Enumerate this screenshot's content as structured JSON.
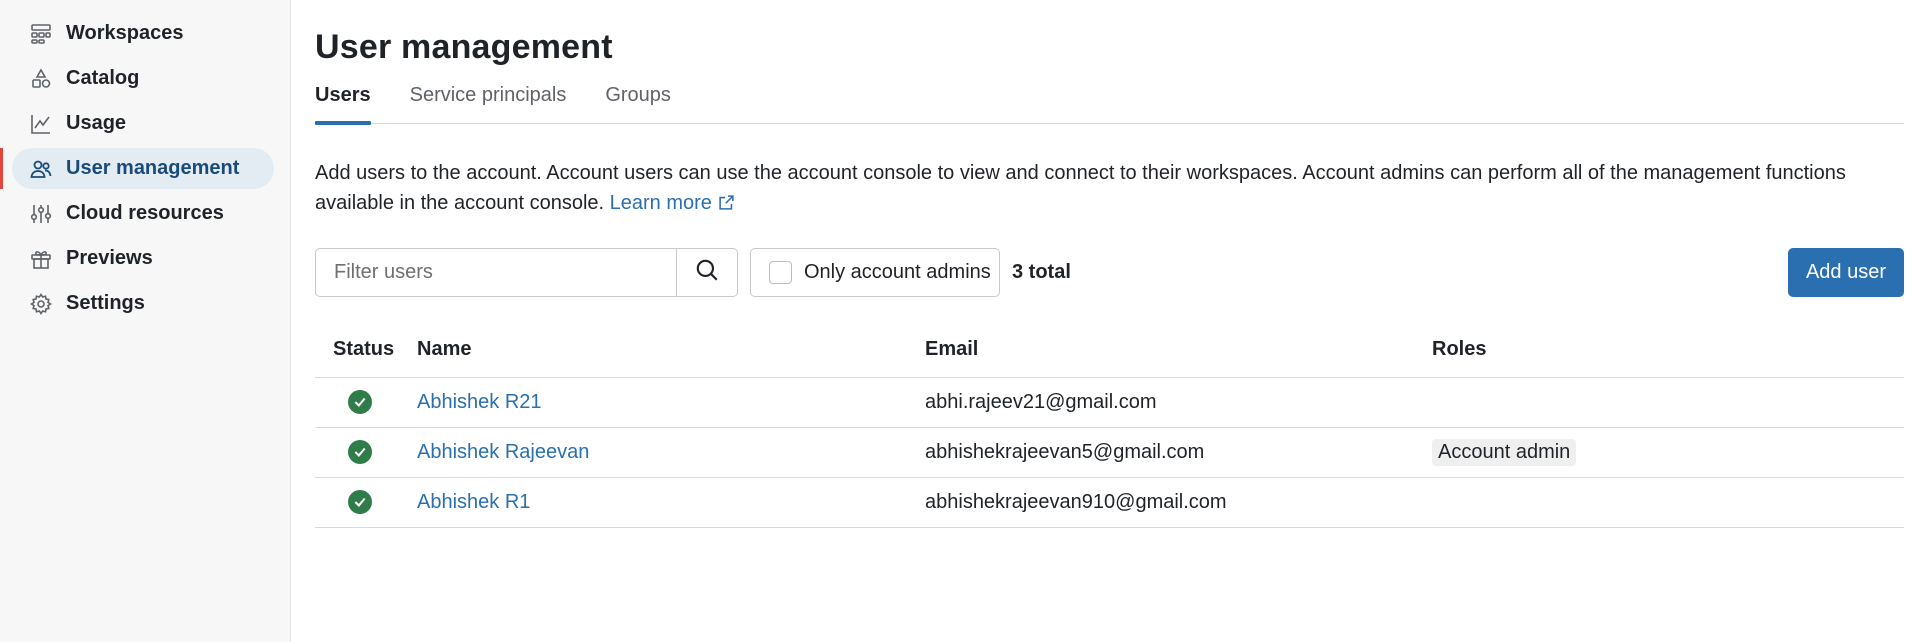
{
  "sidebar": {
    "items": [
      {
        "label": "Workspaces",
        "icon": "workspaces-icon"
      },
      {
        "label": "Catalog",
        "icon": "catalog-icon"
      },
      {
        "label": "Usage",
        "icon": "usage-chart-icon"
      },
      {
        "label": "User management",
        "icon": "users-icon",
        "active": true
      },
      {
        "label": "Cloud resources",
        "icon": "sliders-icon"
      },
      {
        "label": "Previews",
        "icon": "gift-icon"
      },
      {
        "label": "Settings",
        "icon": "gear-icon"
      }
    ]
  },
  "main": {
    "title": "User management",
    "tabs": [
      {
        "label": "Users",
        "active": true
      },
      {
        "label": "Service principals"
      },
      {
        "label": "Groups"
      }
    ],
    "description": "Add users to the account. Account users can use the account console to view and connect to their workspaces. Account admins can perform all of the management functions available in the account console.",
    "learn_more": "Learn more",
    "filter": {
      "placeholder": "Filter users",
      "admin_only_label": "Only account admins",
      "total": "3 total"
    },
    "add_user_label": "Add user",
    "table": {
      "headers": [
        "Status",
        "Name",
        "Email",
        "Roles"
      ],
      "rows": [
        {
          "status": "active",
          "name": "Abhishek R21",
          "email": "abhi.rajeev21@gmail.com",
          "role": ""
        },
        {
          "status": "active",
          "name": "Abhishek Rajeevan",
          "email": "abhishekrajeevan5@gmail.com",
          "role": "Account admin"
        },
        {
          "status": "active",
          "name": "Abhishek R1",
          "email": "abhishekrajeevan910@gmail.com",
          "role": ""
        }
      ]
    }
  },
  "colors": {
    "accent": "#2a6fb0",
    "active_nav_bg": "#e4ecf3",
    "active_nav_marker": "#e0463b",
    "status_active": "#2e7d49"
  }
}
